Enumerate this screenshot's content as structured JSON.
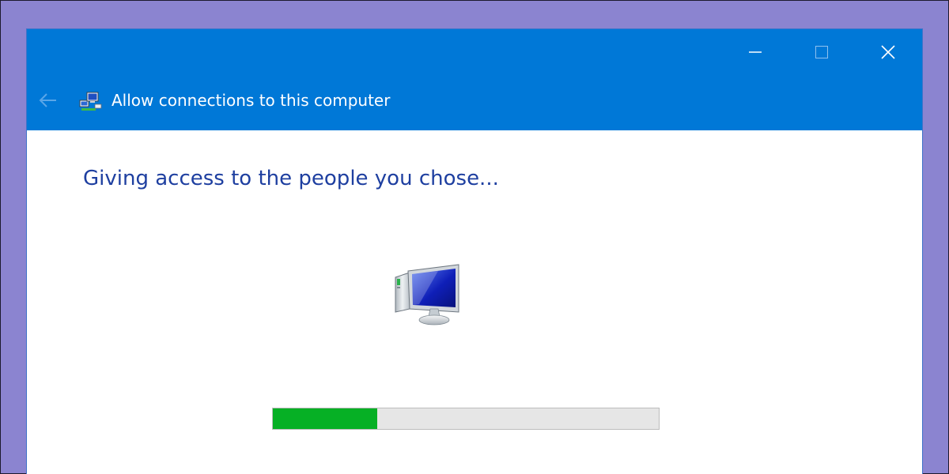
{
  "window": {
    "title": "Allow connections to this computer",
    "controls": {
      "minimize_icon": "minimize-icon",
      "maximize_icon": "maximize-icon",
      "close_icon": "close-icon",
      "back_icon": "back-arrow-icon"
    },
    "title_icon": "network-computers-icon"
  },
  "main": {
    "heading": "Giving access to the people you chose...",
    "illustration_icon": "computer-icon",
    "progress": {
      "fraction": 0.27
    }
  },
  "colors": {
    "desktop_background": "#8b84d0",
    "titlebar": "#0078d7",
    "heading_text": "#1e3fa0",
    "progress_fill": "#06b025",
    "progress_track": "#e6e6e6"
  }
}
